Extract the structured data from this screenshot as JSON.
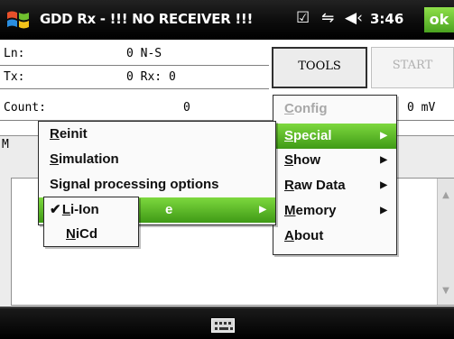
{
  "titlebar": {
    "title": "GDD Rx - !!! NO RECEIVER !!!",
    "time": "3:46",
    "ok": "ok",
    "icons": [
      "windows-start-icon",
      "checklist-icon",
      "connectivity-icon",
      "volume-icon"
    ]
  },
  "readout": {
    "ln_label": "Ln:",
    "ln_value": "0 N-S",
    "tx_label": "Tx:",
    "tx_value": "0 Rx: 0",
    "count_label": "Count:",
    "count_value": "0",
    "mv_value": "0 mV",
    "m_label": "M"
  },
  "buttons": {
    "tools": "TOOLS",
    "start": "START"
  },
  "tools_menu": {
    "items": [
      {
        "label": "Config",
        "underline": "C",
        "rest": "onfig",
        "state": "disabled",
        "submenu": false
      },
      {
        "label": "Special",
        "underline": "S",
        "rest": "pecial",
        "state": "selected",
        "submenu": true
      },
      {
        "label": "Show",
        "underline": "S",
        "rest": "how",
        "state": "normal",
        "submenu": true
      },
      {
        "label": "Raw Data",
        "underline": "R",
        "rest": "aw Data",
        "state": "normal",
        "submenu": true
      },
      {
        "label": "Memory",
        "underline": "M",
        "rest": "emory",
        "state": "normal",
        "submenu": true
      },
      {
        "label": "About",
        "underline": "A",
        "rest": "bout",
        "state": "normal",
        "submenu": false
      }
    ]
  },
  "special_menu": {
    "items": [
      {
        "underline": "R",
        "rest": "einit"
      },
      {
        "underline": "S",
        "rest": "imulation"
      },
      {
        "underline": "",
        "rest": "Signal processing options"
      },
      {
        "underline": "",
        "rest": "e",
        "submenu": true
      }
    ]
  },
  "battery_menu": {
    "items": [
      {
        "check": "✔",
        "underline": "L",
        "rest": "i-Ion",
        "checked": true
      },
      {
        "check": "",
        "underline": "N",
        "rest": "iCd",
        "checked": false
      }
    ]
  },
  "colors": {
    "menu_highlight": "#4aa320",
    "titlebar": "#000000",
    "ok_button": "#6cc433"
  }
}
